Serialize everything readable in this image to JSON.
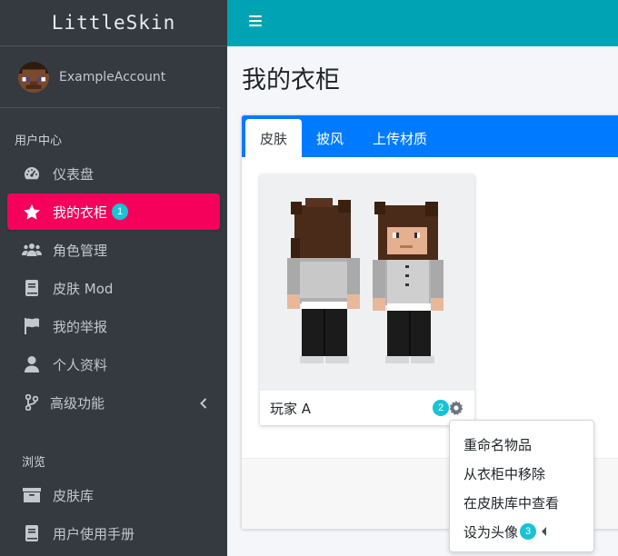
{
  "brand": "LittleSkin",
  "user": {
    "name": "ExampleAccount",
    "avatar_icon": "steve-avatar"
  },
  "sidebar": {
    "header_user": "用户中心",
    "header_browse": "浏览",
    "items": [
      {
        "label": "仪表盘",
        "icon": "tachometer-icon"
      },
      {
        "label": "我的衣柜",
        "icon": "star-icon",
        "active": true,
        "badge": "1"
      },
      {
        "label": "角色管理",
        "icon": "users-icon"
      },
      {
        "label": "皮肤 Mod",
        "icon": "book-icon"
      },
      {
        "label": "我的举报",
        "icon": "flag-icon"
      },
      {
        "label": "个人资料",
        "icon": "user-icon"
      },
      {
        "label": "高级功能",
        "icon": "code-branch-icon"
      }
    ],
    "browse_items": [
      {
        "label": "皮肤库",
        "icon": "archive-icon"
      },
      {
        "label": "用户使用手册",
        "icon": "book-icon"
      }
    ]
  },
  "page": {
    "title": "我的衣柜"
  },
  "tabs": [
    {
      "label": "皮肤",
      "active": true
    },
    {
      "label": "披风"
    },
    {
      "label": "上传材质"
    }
  ],
  "closet_item": {
    "name": "玩家 A",
    "badge": "2"
  },
  "menu": {
    "items": [
      "重命名物品",
      "从衣柜中移除",
      "在皮肤库中查看",
      "设为头像"
    ],
    "badge": "3"
  },
  "colors": {
    "accent": "#f5005a",
    "topbar": "#00a3b4",
    "tabs": "#007bff",
    "badge": "#17c3d4"
  }
}
